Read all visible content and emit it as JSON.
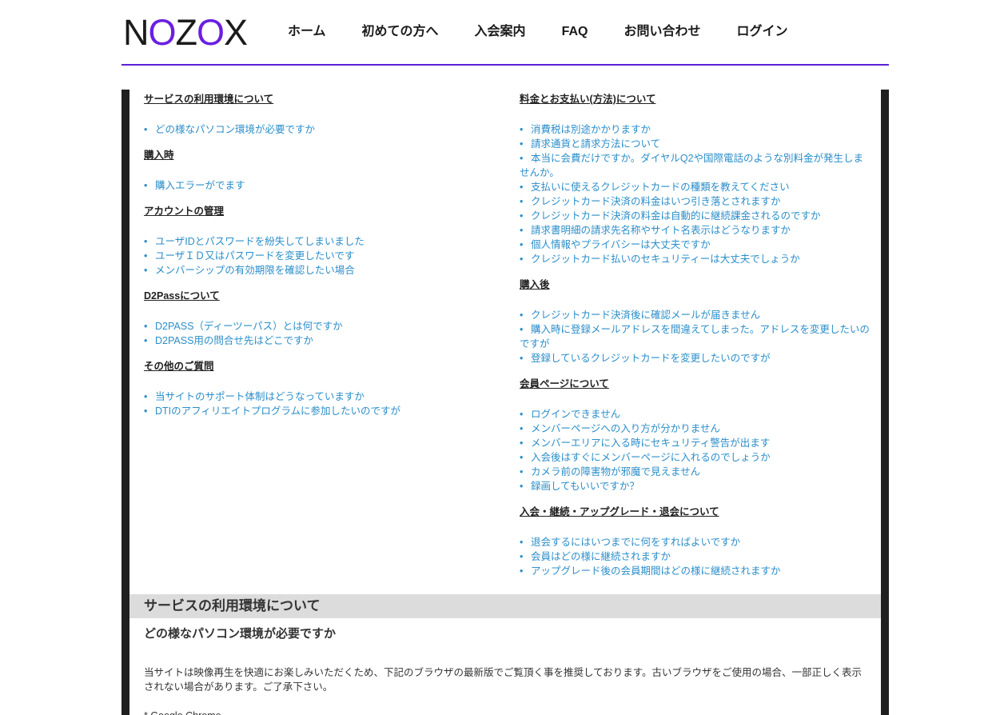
{
  "brand": {
    "logo_a": "N",
    "logo_b": "O",
    "logo_c": "Z",
    "logo_d": "O",
    "logo_e": "X"
  },
  "nav": [
    "ホーム",
    "初めての方へ",
    "入会案内",
    "FAQ",
    "お問い合わせ",
    "ログイン"
  ],
  "colors": {
    "accent": "#5a1fd6",
    "link": "#2b8ec9",
    "frame": "#1f1f1f",
    "band": "#dcdcdc"
  },
  "left_sections": [
    {
      "title": "サービスの利用環境について",
      "items": [
        "どの様なパソコン環境が必要ですか"
      ]
    },
    {
      "title": "購入時",
      "items": [
        "購入エラーがでます"
      ]
    },
    {
      "title": "アカウントの管理",
      "items": [
        "ユーザIDとパスワードを紛失してしまいました",
        "ユーザＩＤ又はパスワードを変更したいです",
        "メンバーシップの有効期限を確認したい場合"
      ]
    },
    {
      "title": "D2Passについて",
      "items": [
        "D2PASS（ディーツーパス）とは何ですか",
        "D2PASS用の問合せ先はどこですか"
      ]
    },
    {
      "title": "その他のご質問",
      "items": [
        "当サイトのサポート体制はどうなっていますか",
        "DTIのアフィリエイトプログラムに参加したいのですが"
      ]
    }
  ],
  "right_sections": [
    {
      "title": "料金とお支払い(方法)について",
      "items": [
        "消費税は別途かかりますか",
        "請求通貨と請求方法について",
        "本当に会費だけですか。ダイヤルQ2や国際電話のような別料金が発生しませんか。",
        "支払いに使えるクレジットカードの種類を教えてください",
        "クレジットカード決済の料金はいつ引き落とされますか",
        "クレジットカード決済の料金は自動的に継続課金されるのですか",
        "請求書明細の請求先名称やサイト名表示はどうなりますか",
        "個人情報やプライバシーは大丈夫ですか",
        "クレジットカード払いのセキュリティーは大丈夫でしょうか"
      ]
    },
    {
      "title": "購入後",
      "items": [
        "クレジットカード決済後に確認メールが届きません",
        "購入時に登録メールアドレスを間違えてしまった。アドレスを変更したいのですが",
        "登録しているクレジットカードを変更したいのですが"
      ]
    },
    {
      "title": "会員ページについて",
      "items": [
        "ログインできません",
        "メンバーページへの入り方が分かりません",
        "メンバーエリアに入る時にセキュリティ警告が出ます",
        "入会後はすぐにメンバーページに入れるのでしょうか",
        "カメラ前の障害物が邪魔で見えません",
        "録画してもいいですか？"
      ]
    },
    {
      "title": "入会・継続・アップグレード・退会について",
      "items": [
        "退会するにはいつまでに何をすればよいですか",
        "会員はどの様に継続されますか",
        "アップグレード後の会員期間はどの様に継続されますか"
      ]
    }
  ],
  "detail": {
    "section_title": "サービスの利用環境について",
    "question": "どの様なパソコン環境が必要ですか",
    "answer": "当サイトは映像再生を快適にお楽しみいただくため、下記のブラウザの最新版でご覧頂く事を推奨しております。古いブラウザをご使用の場合、一部正しく表示されない場合があります。ご了承下さい。",
    "browser_first": "* Google Chrome"
  }
}
